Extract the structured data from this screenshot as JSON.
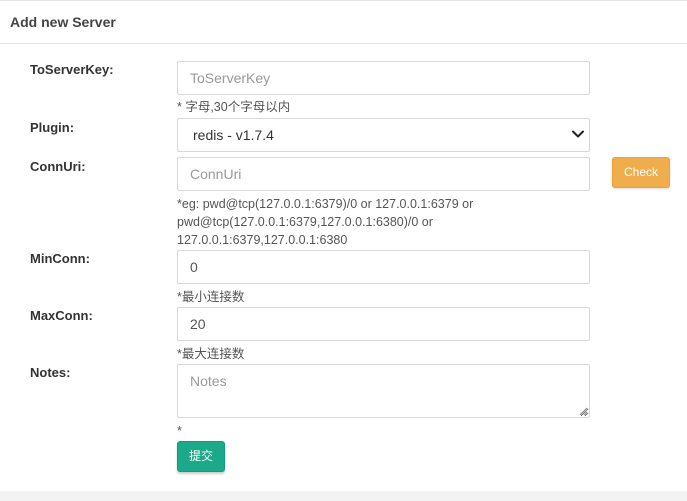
{
  "header": {
    "title": "Add new Server"
  },
  "form": {
    "to_server_key": {
      "label": "ToServerKey:",
      "value": "",
      "placeholder": "ToServerKey",
      "help": "* 字母,30个字母以内"
    },
    "plugin": {
      "label": "Plugin:",
      "selected": "redis - v1.7.4"
    },
    "conn_uri": {
      "label": "ConnUri:",
      "value": "",
      "placeholder": "ConnUri",
      "help_line1": "*eg: pwd@tcp(127.0.0.1:6379)/0 or 127.0.0.1:6379 or",
      "help_line2": "pwd@tcp(127.0.0.1:6379,127.0.0.1:6380)/0 or",
      "help_line3": "127.0.0.1:6379,127.0.0.1:6380",
      "check_label": "Check"
    },
    "min_conn": {
      "label": "MinConn:",
      "value": "0",
      "help": "*最小连接数"
    },
    "max_conn": {
      "label": "MaxConn:",
      "value": "20",
      "help": "*最大连接数"
    },
    "notes": {
      "label": "Notes:",
      "value": "",
      "placeholder": "Notes",
      "help": "*"
    },
    "submit_label": "提交"
  },
  "colors": {
    "check_button": "#f0ad4e",
    "submit_button": "#1aaa8a",
    "border": "#d8d8d8"
  },
  "icons": {
    "select_arrow": "chevron-down-icon",
    "textarea_grip": "resize-grip-icon"
  }
}
